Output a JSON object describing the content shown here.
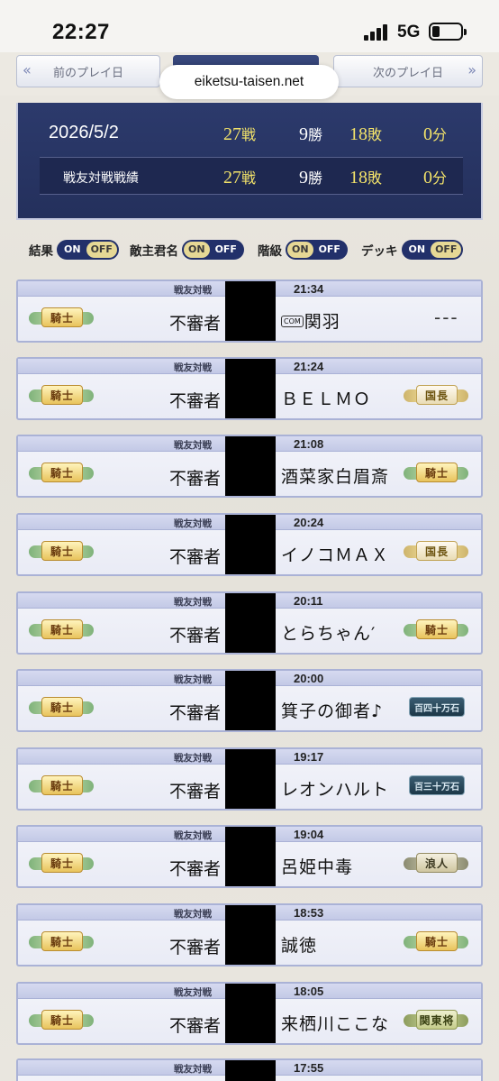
{
  "status_bar": {
    "time": "22:27",
    "network": "5G"
  },
  "nav": {
    "prev_label": "前のプレイ日",
    "next_label": "次のプレイ日",
    "url": "eiketsu-taisen.net"
  },
  "summary": {
    "date": "2026/5/2",
    "total": {
      "battles": "27",
      "battles_unit": "戦",
      "wins": "9",
      "wins_unit": "勝",
      "losses": "18",
      "losses_unit": "敗",
      "draws": "0",
      "draws_unit": "分"
    },
    "sub_label": "戦友対戦戦績",
    "friend": {
      "battles": "27",
      "battles_unit": "戦",
      "wins": "9",
      "wins_unit": "勝",
      "losses": "18",
      "losses_unit": "敗",
      "draws": "0",
      "draws_unit": "分"
    }
  },
  "toggles": [
    {
      "label": "結果",
      "on": "ON",
      "off": "OFF"
    },
    {
      "label": "敵主君名",
      "on": "ON",
      "off": "OFF"
    },
    {
      "label": "階級",
      "on": "ON",
      "off": "OFF"
    },
    {
      "label": "デッキ",
      "on": "ON",
      "off": "OFF"
    }
  ],
  "battles": [
    {
      "type": "戦友対戦",
      "time": "21:34",
      "player": "不審者",
      "opponent": "関羽",
      "com": "COM",
      "player_rank": "騎士",
      "opponent_rank": "---"
    },
    {
      "type": "戦友対戦",
      "time": "21:24",
      "player": "不審者",
      "opponent": "ＢＥＬＭＯ",
      "player_rank": "騎士",
      "opponent_rank": "国長"
    },
    {
      "type": "戦友対戦",
      "time": "21:08",
      "player": "不審者",
      "opponent": "酒菜家白眉斎",
      "player_rank": "騎士",
      "opponent_rank": "騎士"
    },
    {
      "type": "戦友対戦",
      "time": "20:24",
      "player": "不審者",
      "opponent": "イノコＭＡＸ",
      "player_rank": "騎士",
      "opponent_rank": "国長"
    },
    {
      "type": "戦友対戦",
      "time": "20:11",
      "player": "不審者",
      "opponent": "とらちゃん′",
      "player_rank": "騎士",
      "opponent_rank": "騎士"
    },
    {
      "type": "戦友対戦",
      "time": "20:00",
      "player": "不審者",
      "opponent": "箕子の御者♪",
      "player_rank": "騎士",
      "opponent_rank": "百四十万石"
    },
    {
      "type": "戦友対戦",
      "time": "19:17",
      "player": "不審者",
      "opponent": "レオンハルト",
      "player_rank": "騎士",
      "opponent_rank": "百三十万石"
    },
    {
      "type": "戦友対戦",
      "time": "19:04",
      "player": "不審者",
      "opponent": "呂姫中毒",
      "player_rank": "騎士",
      "opponent_rank": "浪人"
    },
    {
      "type": "戦友対戦",
      "time": "18:53",
      "player": "不審者",
      "opponent": "誠徳",
      "player_rank": "騎士",
      "opponent_rank": "騎士"
    },
    {
      "type": "戦友対戦",
      "time": "18:05",
      "player": "不審者",
      "opponent": "来栖川ここな",
      "player_rank": "騎士",
      "opponent_rank": "関東将"
    },
    {
      "type": "戦友対戦",
      "time": "17:55"
    }
  ]
}
